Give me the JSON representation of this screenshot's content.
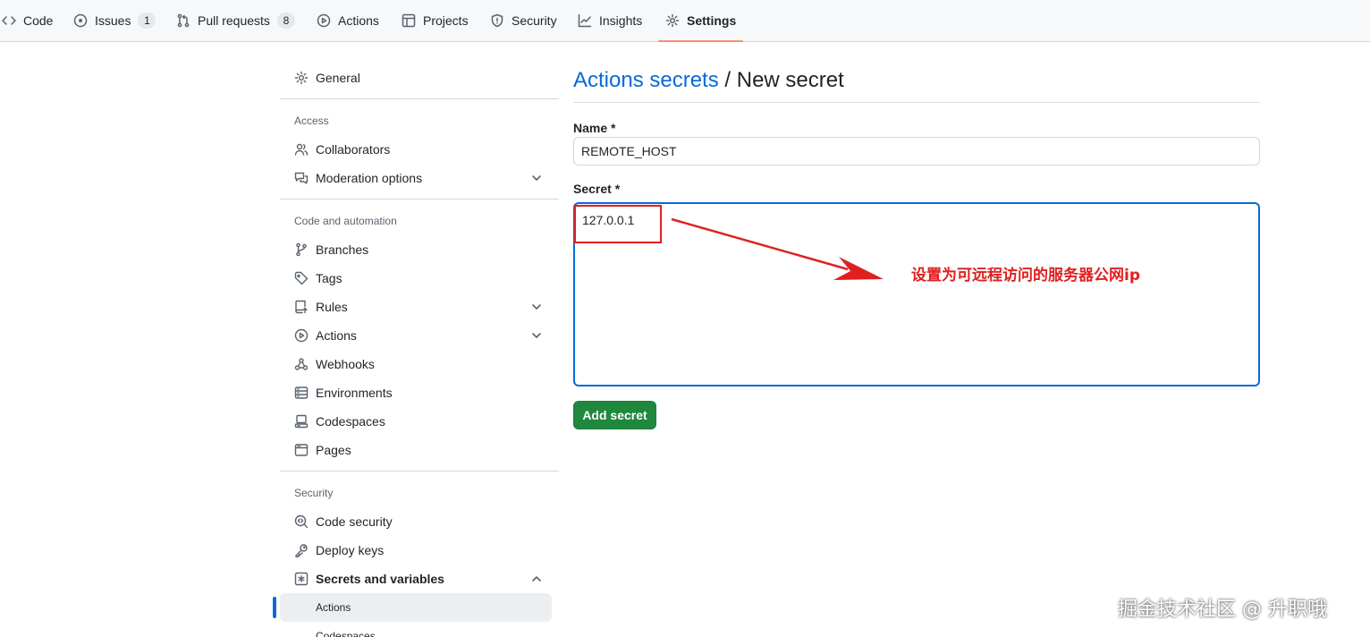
{
  "repo_nav": {
    "tabs": [
      {
        "label": "Code",
        "icon": "code-icon"
      },
      {
        "label": "Issues",
        "icon": "issue-opened-icon",
        "count": "1"
      },
      {
        "label": "Pull requests",
        "icon": "git-pull-request-icon",
        "count": "8"
      },
      {
        "label": "Actions",
        "icon": "play-icon"
      },
      {
        "label": "Projects",
        "icon": "table-icon"
      },
      {
        "label": "Security",
        "icon": "shield-icon"
      },
      {
        "label": "Insights",
        "icon": "graph-icon"
      },
      {
        "label": "Settings",
        "icon": "gear-icon",
        "active": true
      }
    ]
  },
  "sidebar": {
    "general": "General",
    "access_heading": "Access",
    "collaborators": "Collaborators",
    "moderation": "Moderation options",
    "code_automation_heading": "Code and automation",
    "branches": "Branches",
    "tags": "Tags",
    "rules": "Rules",
    "actions": "Actions",
    "webhooks": "Webhooks",
    "environments": "Environments",
    "codespaces": "Codespaces",
    "pages": "Pages",
    "security_heading": "Security",
    "code_security": "Code security",
    "deploy_keys": "Deploy keys",
    "secrets_variables": "Secrets and variables",
    "sub_actions": "Actions",
    "sub_codespaces": "Codespaces"
  },
  "main": {
    "title_link": "Actions secrets",
    "title_rest": " / New secret",
    "name_label": "Name *",
    "name_value": "REMOTE_HOST",
    "secret_label": "Secret *",
    "secret_value": "127.0.0.1",
    "submit_label": "Add secret"
  },
  "annotation": {
    "text": "设置为可远程访问的服务器公网ip",
    "color": "#e02020"
  },
  "watermark": "掘金技术社区 @ 升职哦",
  "colors": {
    "link": "#0969da",
    "primary_button": "#1f883d",
    "active_tab_underline": "#fd8c73",
    "focus_border": "#0969da"
  }
}
